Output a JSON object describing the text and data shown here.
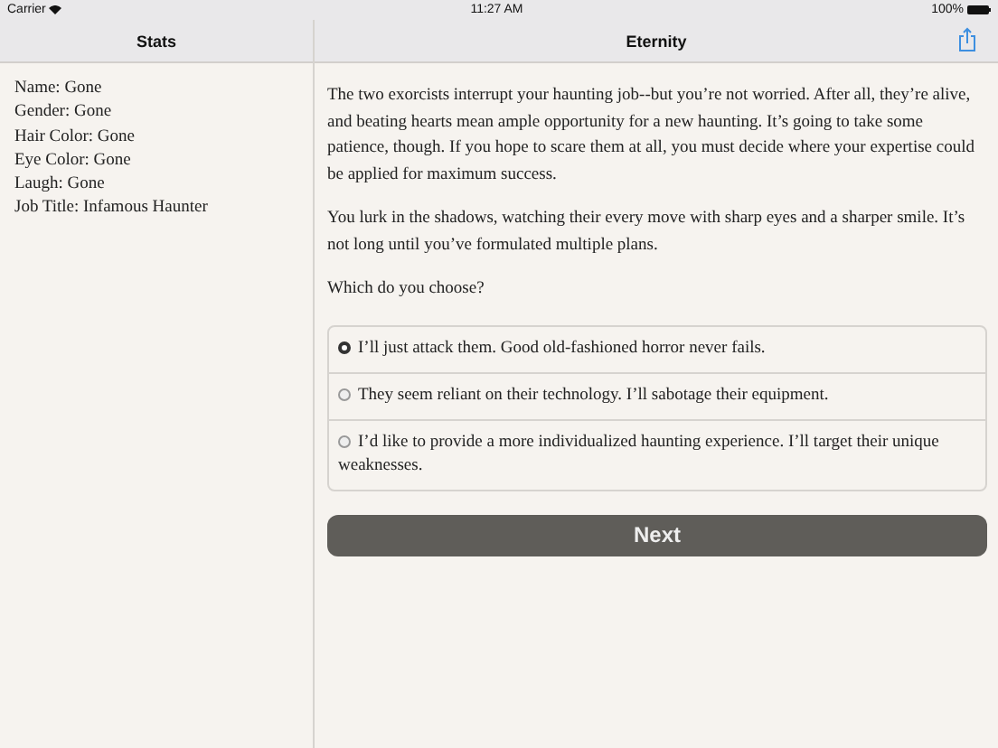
{
  "status_bar": {
    "carrier": "Carrier",
    "time": "11:27 AM",
    "battery": "100%"
  },
  "sidebar": {
    "title": "Stats",
    "stats": [
      "Name: Gone",
      "Gender: Gone",
      "Hair Color: Gone",
      "Eye Color: Gone",
      "Laugh: Gone",
      "Job Title: Infamous Haunter"
    ]
  },
  "main": {
    "title": "Eternity",
    "paragraphs": [
      "The two exorcists interrupt your haunting job--but you’re not worried. After all, they’re alive, and beating hearts mean ample opportunity for a new haunting. It’s going to take some patience, though. If you hope to scare them at all, you must decide where your expertise could be applied for maximum success.",
      "You lurk in the shadows, watching their every move with sharp eyes and a sharper smile. It’s not long until you’ve formulated multiple plans.",
      "Which do you choose?"
    ],
    "choices": [
      {
        "label": "I’ll just attack them. Good old-fashioned horror never fails.",
        "selected": true
      },
      {
        "label": "They seem reliant on their technology. I’ll sabotage their equipment.",
        "selected": false
      },
      {
        "label": "I’d like to provide a more individualized haunting experience. I’ll target their unique weaknesses.",
        "selected": false
      }
    ],
    "button": "Next"
  }
}
